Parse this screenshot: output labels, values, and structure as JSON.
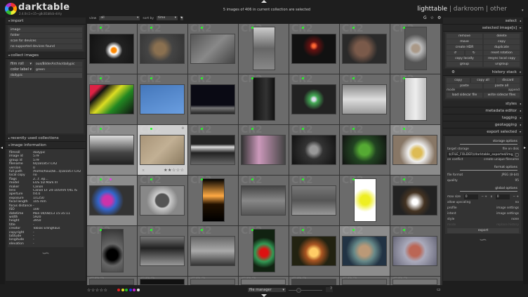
{
  "header": {
    "app_name": "darktable",
    "version": "2.4.0rc1+15~g8c81b8cb-dirty",
    "status": "5 images of 406 in current collection are selected",
    "views": [
      "lighttable",
      "darkroom",
      "other"
    ],
    "active_view": "lighttable",
    "separator": "|"
  },
  "filter": {
    "view_label": "view",
    "view_value": "all",
    "sort_label": "sort by",
    "sort_value": "time",
    "sort_dir": "▴",
    "icons": [
      "g-icon",
      "star-icon",
      "gear-icon"
    ]
  },
  "left": {
    "import": {
      "title": "import",
      "items": [
        "image",
        "folder",
        "scan for devices",
        "no supported devices found"
      ]
    },
    "collect": {
      "title": "collect images",
      "rules": [
        {
          "prop": "film roll",
          "value": "ous/BilderArchiv/dailypic"
        },
        {
          "prop": "color label",
          "value": "green"
        }
      ],
      "list": [
        "dailypic"
      ]
    },
    "recent": {
      "title": "recently used collections"
    },
    "info": {
      "title": "image information",
      "rows": [
        [
          "filmroll",
          "dailypic"
        ],
        [
          "image id",
          "579"
        ],
        [
          "group id",
          "579"
        ],
        [
          "filename",
          "6Q1B1857.CR2"
        ],
        [
          "version",
          "0"
        ],
        [
          "full path",
          "/home/houz/Bi...Q1B1857.CR2"
        ],
        [
          "local copy",
          "no"
        ],
        [
          "flags",
          "2...t .ep..."
        ],
        [
          "model",
          "EOS 5D Mark III"
        ],
        [
          "maker",
          "Canon"
        ],
        [
          "lens",
          "Canon EF 24-105mm f/4L IS"
        ],
        [
          "aperture",
          "f/4.0"
        ],
        [
          "exposure",
          "1/1250"
        ],
        [
          "focal length",
          "105 mm"
        ],
        [
          "focus distance",
          "-"
        ],
        [
          "ISO",
          "100"
        ],
        [
          "datetime",
          "Mon 04/08/13 15:35:11"
        ],
        [
          "width",
          "5920"
        ],
        [
          "height",
          "3950"
        ],
        [
          "title",
          "-"
        ],
        [
          "creator",
          "Tobias Ellinghaus"
        ],
        [
          "copyright",
          "-"
        ],
        [
          "latitude",
          "-"
        ],
        [
          "longitude",
          "-"
        ],
        [
          "elevation",
          "-"
        ]
      ]
    }
  },
  "right": {
    "select": {
      "title": "select"
    },
    "selected": {
      "title": "selected image[s]",
      "buttons": [
        "remove",
        "delete",
        "move",
        "copy",
        "create HDR",
        "duplicate",
        "↺",
        "↻",
        "reset rotation",
        "copy locally",
        "resync local copy",
        "group",
        "ungroup"
      ]
    },
    "history": {
      "title": "history stack",
      "buttons": [
        "copy",
        "copy all",
        "discard",
        "paste",
        "paste all"
      ],
      "mode_label": "mode",
      "mode_value": "append",
      "load": "load sidecar file",
      "write": "write sidecar files"
    },
    "styles": {
      "title": "styles"
    },
    "metadata": {
      "title": "metadata editor"
    },
    "tagging": {
      "title": "tagging"
    },
    "geotagging": {
      "title": "geotagging"
    },
    "export": {
      "title": "export selected",
      "storage_header": "storage options",
      "target_label": "target storage",
      "target_value": "file on disk",
      "path": "$(FILE_FOLDER)/darktable_exported/img_",
      "conflict_label": "on conflict",
      "conflict_value": "create unique filename",
      "format_header": "format options",
      "format_label": "file format",
      "format_value": "JPEG (8-bit)",
      "quality_label": "quality",
      "quality_value": "95",
      "global_header": "global options",
      "max_size_label": "max size",
      "max_w": "0",
      "max_h": "0",
      "x": "x",
      "upscale_label": "allow upscaling",
      "upscale_value": "no",
      "profile_label": "profile",
      "profile_value": "image settings",
      "intent_label": "intent",
      "intent_value": "image settings",
      "style_label": "style",
      "style_value": "none",
      "mode_label": "mode",
      "mode_value": "replace history",
      "export_button": "export"
    }
  },
  "grid": {
    "ext": "CR2",
    "thumbs": [
      {
        "c": "radial-gradient(circle at 55% 55%,#f80 8%,#fff 14%,#222 30%,#111)"
      },
      {
        "c": "radial-gradient(circle at 45% 50%,#8a7050 20%,#444 45%,#333)"
      },
      {
        "c": "linear-gradient(135deg,#555,#888 50%,#444)"
      },
      {
        "c": "linear-gradient(180deg,#ccc,#666 50%,#888)",
        "p": 1
      },
      {
        "c": "radial-gradient(circle at 50% 40%,#f63 5%,#611 15%,#111 40%)"
      },
      {
        "c": "radial-gradient(circle at 45% 50%,#7a5a4a 25%,#2a2a2a 55%)"
      },
      {
        "c": "radial-gradient(circle at 50% 50%,#a98 15%,#bbb 25%,#555 60%)",
        "p": 1
      },
      {
        "c": "linear-gradient(135deg,#d24 15%,#111 25%,#dd2 45%,#282 65%,#111)"
      },
      {
        "c": "linear-gradient(160deg,#47b,#6a9ee0)"
      },
      {
        "c": "linear-gradient(180deg,#0a0a14 70%,#777 80%,#222)"
      },
      {
        "c": "linear-gradient(90deg,#111,#333 60%,#111)",
        "p": 1
      },
      {
        "c": "radial-gradient(circle at 50% 50%,#dde 6%,#4a5 15%,#222 40%)"
      },
      {
        "c": "linear-gradient(180deg,#888,#ddd 50%,#999)"
      },
      {
        "c": "linear-gradient(90deg,#ccc,#eee 50%,#bbb)",
        "p": 1
      },
      {
        "c": "linear-gradient(180deg,#ddd,#444 60%,#222)",
        "s": 1
      },
      {
        "c": "linear-gradient(135deg,#a89478,#c2b094,#8a7a60)",
        "s": 1,
        "h": 1
      },
      {
        "c": "linear-gradient(180deg,#222 30%,#ddd 40%,#222 60%,#666)"
      },
      {
        "c": "linear-gradient(90deg,#333,#c9b 40%,#444)"
      },
      {
        "c": "radial-gradient(circle at 50% 50%,#999 15%,#333 35%,#111)"
      },
      {
        "c": "radial-gradient(circle at 50% 50%,#5a3 20%,#242 45%,#111)"
      },
      {
        "c": "radial-gradient(circle at 55% 60%,#db5 15%,#eee 30%,#876 60%)",
        "s": 1
      },
      {
        "c": "radial-gradient(circle at 40% 50%,#c3a 15%,#36c 30%,#333 55%)",
        "s": 1,
        "m": 1
      },
      {
        "c": "radial-gradient(circle at 50% 50%,#555 25%,#ccc 30%,#888 60%)"
      },
      {
        "c": "linear-gradient(180deg,#000,#fa4 40%,#210 60%,#000)",
        "p": 1
      },
      {
        "c": "linear-gradient(180deg,#444,#888 50%,#555)"
      },
      {
        "c": "linear-gradient(180deg,#777,#555 50%,#999)"
      },
      {
        "c": "radial-gradient(circle at 50% 50%,#ee2 20%,#fff 50%)",
        "p": 1
      },
      {
        "c": "radial-gradient(circle at 50% 55%,#fff 10%,#432 35%,#222 60%)"
      },
      {
        "c": "radial-gradient(circle at 50% 60%,#000 20%,#666 40%,#333)",
        "p": 1
      },
      {
        "c": "linear-gradient(180deg,#777,#222 40%,#999)"
      },
      {
        "c": "linear-gradient(180deg,#666,#aaa 50%,#333)"
      },
      {
        "c": "radial-gradient(circle at 50% 55%,#d11 15%,#395 35%,#121 60%)",
        "p": 1
      },
      {
        "c": "radial-gradient(circle at 50% 55%,#fc6 15%,#a52 30%,#221 60%)"
      },
      {
        "c": "radial-gradient(circle at 50% 50%,#b97 20%,#688 40%,#234 70%)",
        "s": 1
      },
      {
        "c": "radial-gradient(circle at 50% 50%,#b65 20%,#aab 40%,#667)"
      },
      {
        "c": "#555"
      },
      {
        "c": "#111"
      },
      {
        "c": "#666"
      },
      {
        "c": "#777"
      },
      {
        "c": "#444"
      },
      {
        "c": "#666"
      },
      {
        "c": "#777"
      }
    ]
  },
  "bottom": {
    "stars": "☆☆☆☆☆",
    "labels": [
      "#d22",
      "#dd2",
      "#2b2",
      "#23d",
      "#c2c",
      "#ddd"
    ],
    "layout": "file manager",
    "zoom": "7"
  },
  "colors": {
    "accent_dot": "#22ff22",
    "bg": "#1e1e1e"
  }
}
